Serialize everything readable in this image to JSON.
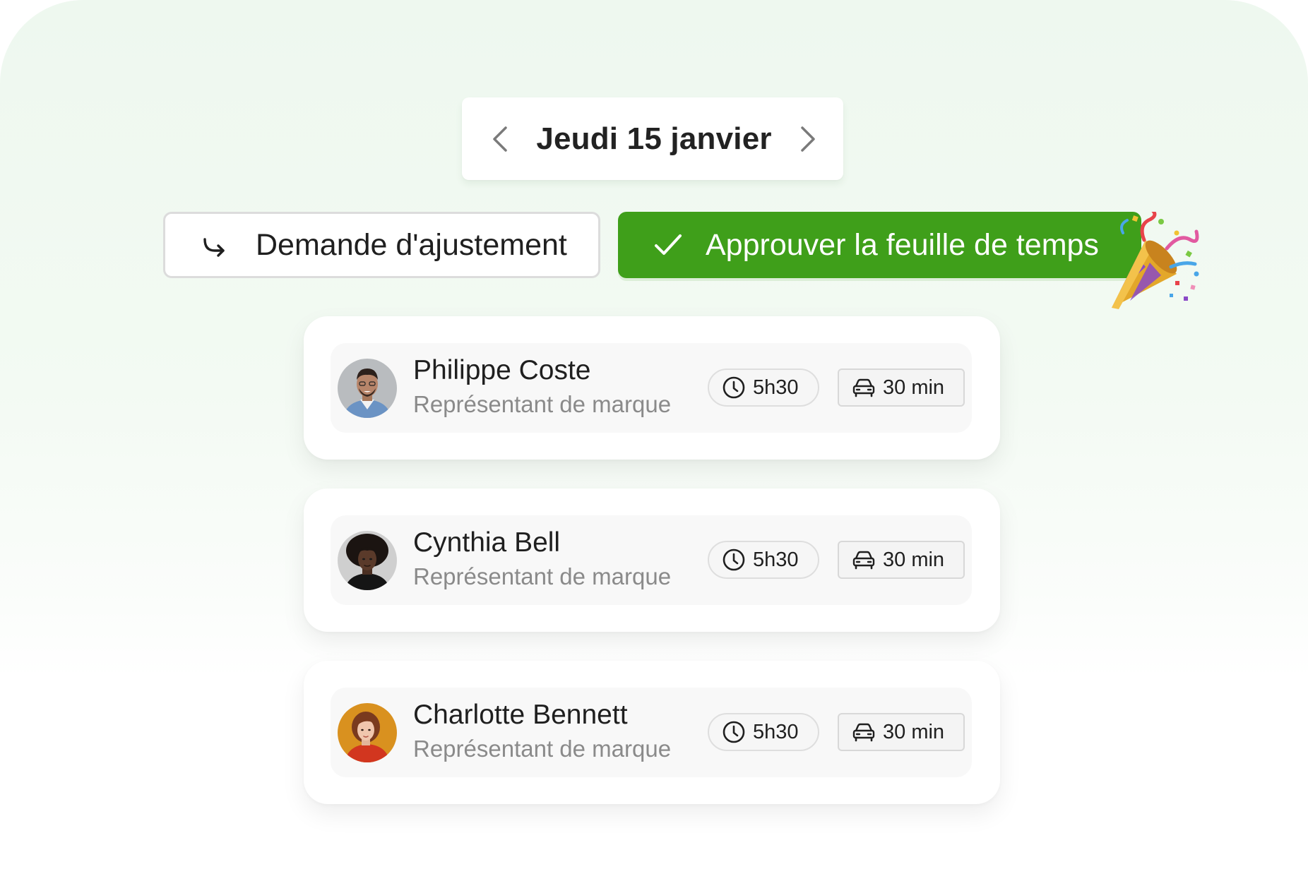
{
  "date_nav": {
    "date": "Jeudi 15 janvier",
    "prev_icon": "chevron-left-icon",
    "next_icon": "chevron-right-icon"
  },
  "actions": {
    "adjust_label": "Demande d'ajustement",
    "adjust_icon": "redirect-arrow-icon",
    "approve_label": "Approuver la feuille de temps",
    "approve_icon": "checkmark-icon",
    "approve_color": "#3f9f1a",
    "celebration_icon": "party-popper-icon"
  },
  "employees": [
    {
      "name": "Philippe Coste",
      "role": "Représentant de marque",
      "hours": "5h30",
      "travel": "30 min"
    },
    {
      "name": "Cynthia Bell",
      "role": "Représentant de marque",
      "hours": "5h30",
      "travel": "30 min"
    },
    {
      "name": "Charlotte Bennett",
      "role": "Représentant de marque",
      "hours": "5h30",
      "travel": "30 min"
    }
  ]
}
